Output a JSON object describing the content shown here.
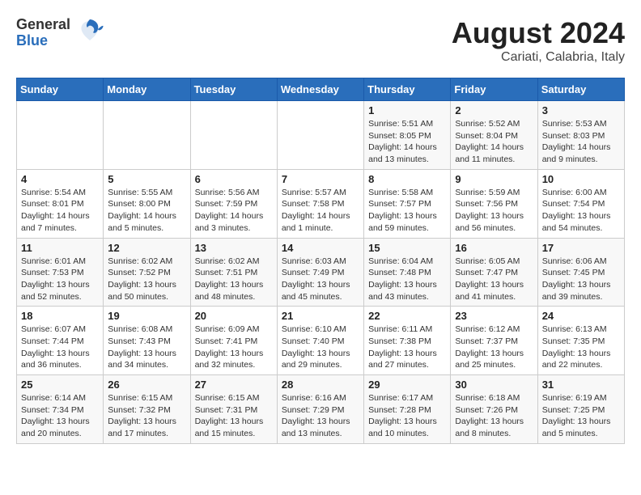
{
  "header": {
    "logo_general": "General",
    "logo_blue": "Blue",
    "month_year": "August 2024",
    "location": "Cariati, Calabria, Italy"
  },
  "calendar": {
    "days_of_week": [
      "Sunday",
      "Monday",
      "Tuesday",
      "Wednesday",
      "Thursday",
      "Friday",
      "Saturday"
    ],
    "weeks": [
      [
        {
          "day": "",
          "info": ""
        },
        {
          "day": "",
          "info": ""
        },
        {
          "day": "",
          "info": ""
        },
        {
          "day": "",
          "info": ""
        },
        {
          "day": "1",
          "info": "Sunrise: 5:51 AM\nSunset: 8:05 PM\nDaylight: 14 hours\nand 13 minutes."
        },
        {
          "day": "2",
          "info": "Sunrise: 5:52 AM\nSunset: 8:04 PM\nDaylight: 14 hours\nand 11 minutes."
        },
        {
          "day": "3",
          "info": "Sunrise: 5:53 AM\nSunset: 8:03 PM\nDaylight: 14 hours\nand 9 minutes."
        }
      ],
      [
        {
          "day": "4",
          "info": "Sunrise: 5:54 AM\nSunset: 8:01 PM\nDaylight: 14 hours\nand 7 minutes."
        },
        {
          "day": "5",
          "info": "Sunrise: 5:55 AM\nSunset: 8:00 PM\nDaylight: 14 hours\nand 5 minutes."
        },
        {
          "day": "6",
          "info": "Sunrise: 5:56 AM\nSunset: 7:59 PM\nDaylight: 14 hours\nand 3 minutes."
        },
        {
          "day": "7",
          "info": "Sunrise: 5:57 AM\nSunset: 7:58 PM\nDaylight: 14 hours\nand 1 minute."
        },
        {
          "day": "8",
          "info": "Sunrise: 5:58 AM\nSunset: 7:57 PM\nDaylight: 13 hours\nand 59 minutes."
        },
        {
          "day": "9",
          "info": "Sunrise: 5:59 AM\nSunset: 7:56 PM\nDaylight: 13 hours\nand 56 minutes."
        },
        {
          "day": "10",
          "info": "Sunrise: 6:00 AM\nSunset: 7:54 PM\nDaylight: 13 hours\nand 54 minutes."
        }
      ],
      [
        {
          "day": "11",
          "info": "Sunrise: 6:01 AM\nSunset: 7:53 PM\nDaylight: 13 hours\nand 52 minutes."
        },
        {
          "day": "12",
          "info": "Sunrise: 6:02 AM\nSunset: 7:52 PM\nDaylight: 13 hours\nand 50 minutes."
        },
        {
          "day": "13",
          "info": "Sunrise: 6:02 AM\nSunset: 7:51 PM\nDaylight: 13 hours\nand 48 minutes."
        },
        {
          "day": "14",
          "info": "Sunrise: 6:03 AM\nSunset: 7:49 PM\nDaylight: 13 hours\nand 45 minutes."
        },
        {
          "day": "15",
          "info": "Sunrise: 6:04 AM\nSunset: 7:48 PM\nDaylight: 13 hours\nand 43 minutes."
        },
        {
          "day": "16",
          "info": "Sunrise: 6:05 AM\nSunset: 7:47 PM\nDaylight: 13 hours\nand 41 minutes."
        },
        {
          "day": "17",
          "info": "Sunrise: 6:06 AM\nSunset: 7:45 PM\nDaylight: 13 hours\nand 39 minutes."
        }
      ],
      [
        {
          "day": "18",
          "info": "Sunrise: 6:07 AM\nSunset: 7:44 PM\nDaylight: 13 hours\nand 36 minutes."
        },
        {
          "day": "19",
          "info": "Sunrise: 6:08 AM\nSunset: 7:43 PM\nDaylight: 13 hours\nand 34 minutes."
        },
        {
          "day": "20",
          "info": "Sunrise: 6:09 AM\nSunset: 7:41 PM\nDaylight: 13 hours\nand 32 minutes."
        },
        {
          "day": "21",
          "info": "Sunrise: 6:10 AM\nSunset: 7:40 PM\nDaylight: 13 hours\nand 29 minutes."
        },
        {
          "day": "22",
          "info": "Sunrise: 6:11 AM\nSunset: 7:38 PM\nDaylight: 13 hours\nand 27 minutes."
        },
        {
          "day": "23",
          "info": "Sunrise: 6:12 AM\nSunset: 7:37 PM\nDaylight: 13 hours\nand 25 minutes."
        },
        {
          "day": "24",
          "info": "Sunrise: 6:13 AM\nSunset: 7:35 PM\nDaylight: 13 hours\nand 22 minutes."
        }
      ],
      [
        {
          "day": "25",
          "info": "Sunrise: 6:14 AM\nSunset: 7:34 PM\nDaylight: 13 hours\nand 20 minutes."
        },
        {
          "day": "26",
          "info": "Sunrise: 6:15 AM\nSunset: 7:32 PM\nDaylight: 13 hours\nand 17 minutes."
        },
        {
          "day": "27",
          "info": "Sunrise: 6:15 AM\nSunset: 7:31 PM\nDaylight: 13 hours\nand 15 minutes."
        },
        {
          "day": "28",
          "info": "Sunrise: 6:16 AM\nSunset: 7:29 PM\nDaylight: 13 hours\nand 13 minutes."
        },
        {
          "day": "29",
          "info": "Sunrise: 6:17 AM\nSunset: 7:28 PM\nDaylight: 13 hours\nand 10 minutes."
        },
        {
          "day": "30",
          "info": "Sunrise: 6:18 AM\nSunset: 7:26 PM\nDaylight: 13 hours\nand 8 minutes."
        },
        {
          "day": "31",
          "info": "Sunrise: 6:19 AM\nSunset: 7:25 PM\nDaylight: 13 hours\nand 5 minutes."
        }
      ]
    ]
  }
}
